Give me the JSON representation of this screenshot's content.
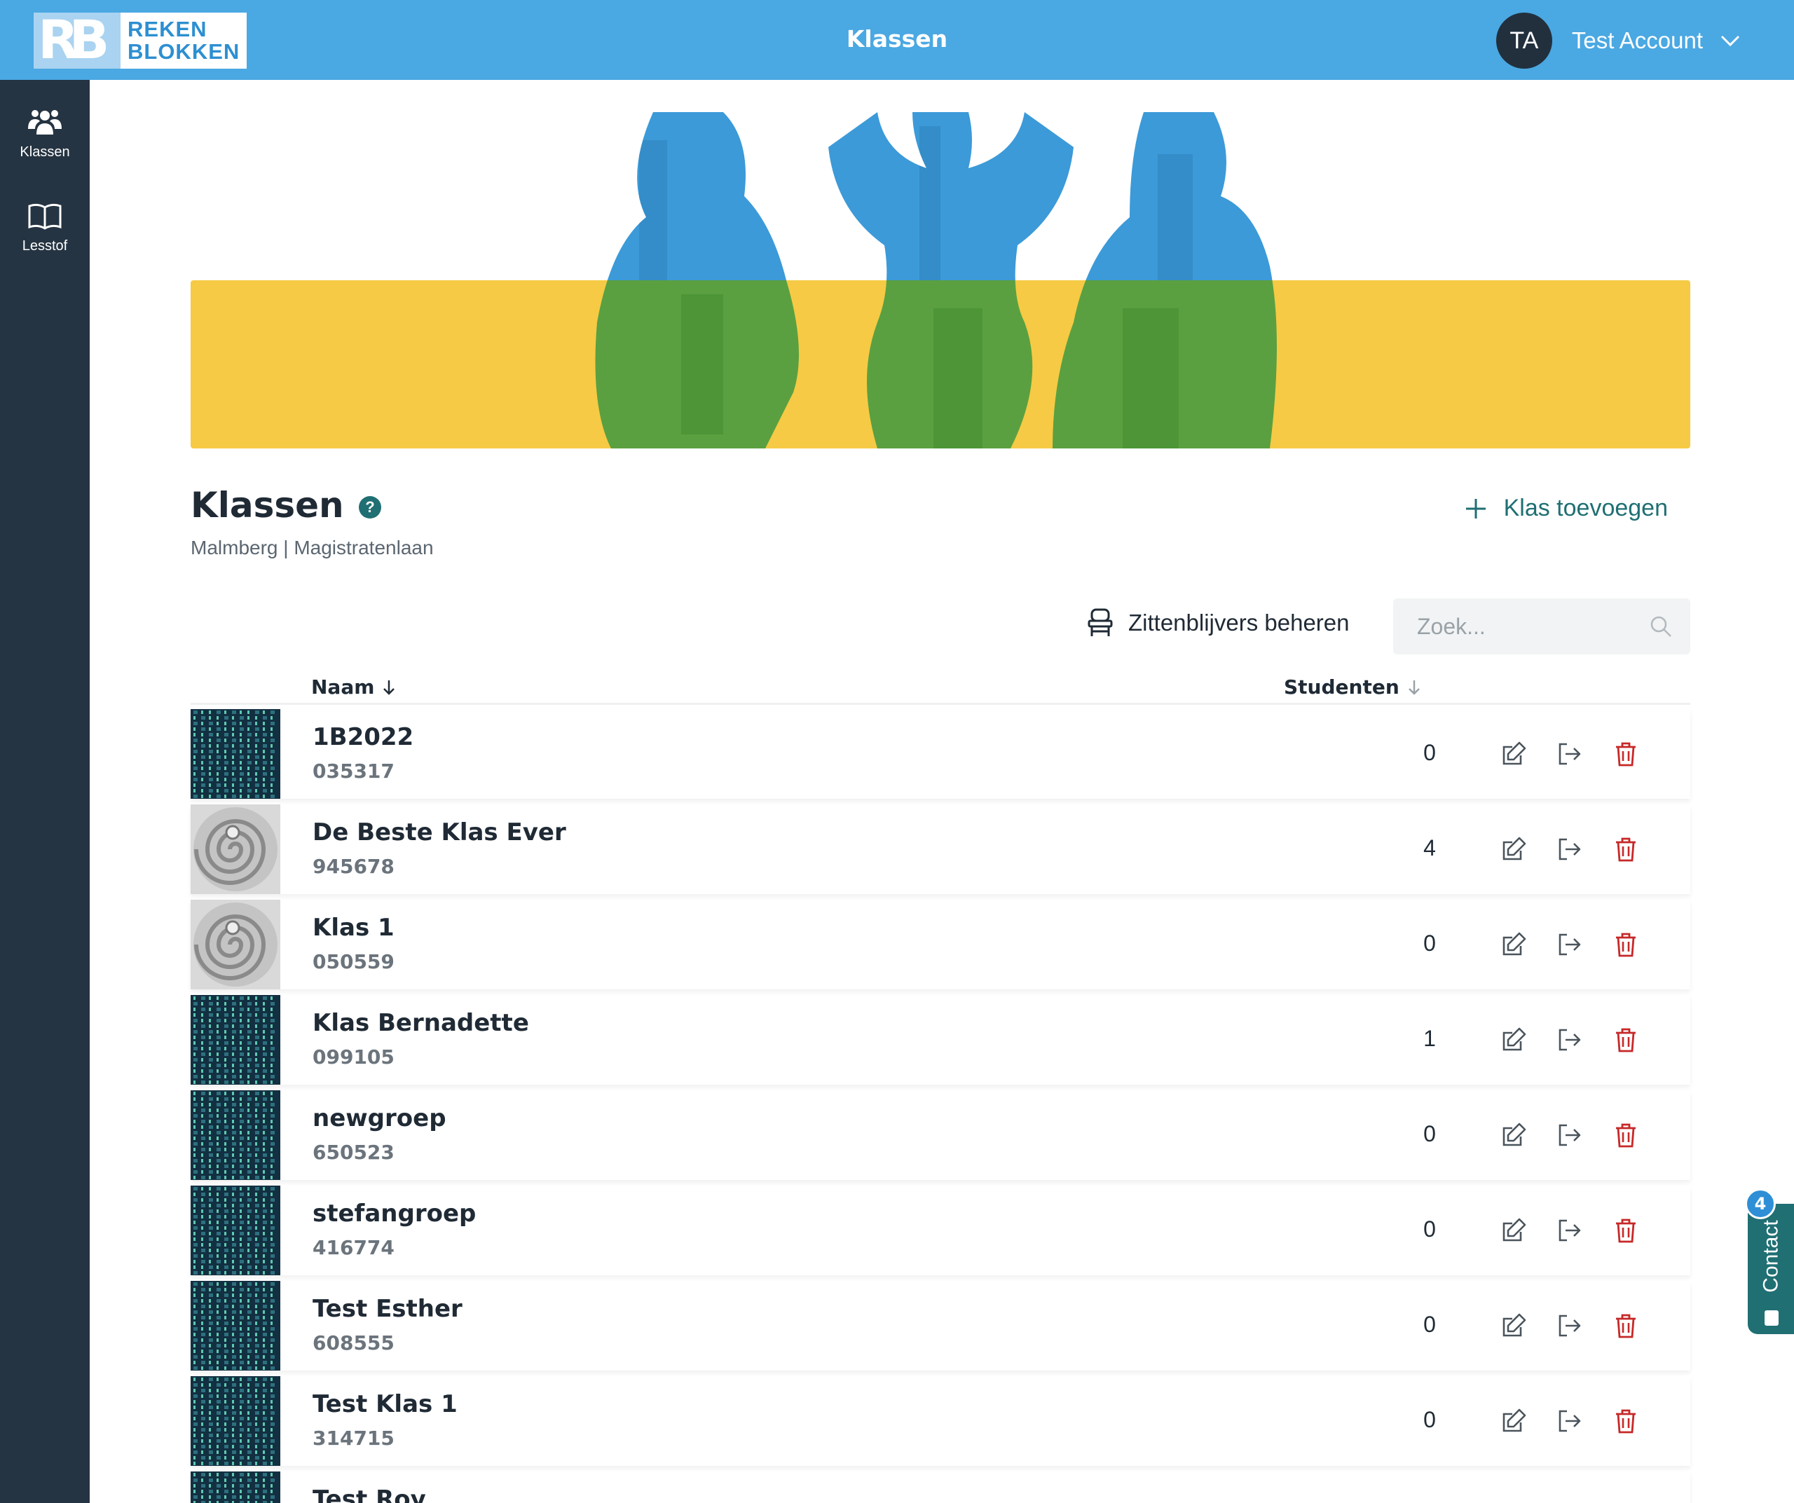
{
  "header": {
    "logo_line1": "REKEN",
    "logo_line2": "BLOKKEN",
    "logo_mark": "RB",
    "title": "Klassen",
    "user_initials": "TA",
    "user_name": "Test Account"
  },
  "sidebar": {
    "items": [
      {
        "label": "Klassen",
        "icon": "users-icon"
      },
      {
        "label": "Lesstof",
        "icon": "book-icon"
      }
    ]
  },
  "page": {
    "title": "Klassen",
    "help": "?",
    "subtitle": "Malmberg | Magistratenlaan",
    "add_label": "Klas toevoegen",
    "manage_label": "Zittenblijvers beheren",
    "search_placeholder": "Zoek..."
  },
  "table": {
    "col_name": "Naam",
    "col_students": "Studenten",
    "rows": [
      {
        "name": "1B2022",
        "code": "035317",
        "students": "0",
        "thumb": "binary"
      },
      {
        "name": "De Beste Klas Ever",
        "code": "945678",
        "students": "4",
        "thumb": "spiral"
      },
      {
        "name": "Klas 1",
        "code": "050559",
        "students": "0",
        "thumb": "spiral"
      },
      {
        "name": "Klas Bernadette",
        "code": "099105",
        "students": "1",
        "thumb": "binary"
      },
      {
        "name": "newgroep",
        "code": "650523",
        "students": "0",
        "thumb": "binary"
      },
      {
        "name": "stefangroep",
        "code": "416774",
        "students": "0",
        "thumb": "binary"
      },
      {
        "name": "Test Esther",
        "code": "608555",
        "students": "0",
        "thumb": "binary"
      },
      {
        "name": "Test Klas 1",
        "code": "314715",
        "students": "0",
        "thumb": "binary"
      },
      {
        "name": "Test Roy",
        "code": "",
        "students": "",
        "thumb": "binary"
      }
    ]
  },
  "contact": {
    "label": "Contact",
    "badge": "4"
  },
  "colors": {
    "topbar": "#4aa8e2",
    "sidebar": "#253442",
    "accent": "#1f6f73",
    "delete": "#c62828",
    "hero_yellow": "#f6ca44",
    "hero_blue": "#3c9ad8",
    "hero_green": "#5aa040"
  }
}
